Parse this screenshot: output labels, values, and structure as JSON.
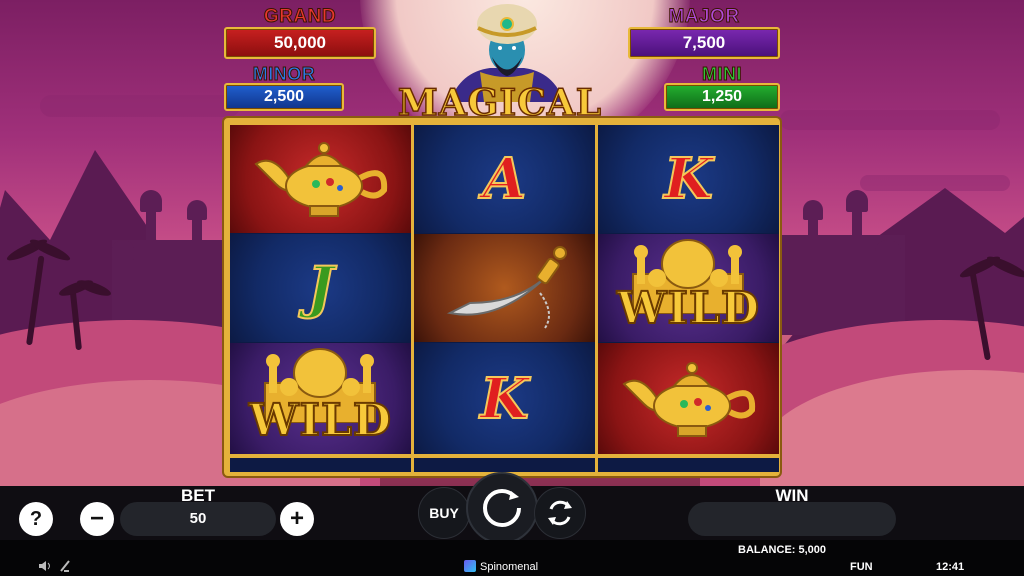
{
  "game": {
    "title": "MAGICAL GENIE"
  },
  "jackpots": {
    "grand": {
      "label": "GRAND",
      "value": "50,000"
    },
    "major": {
      "label": "MAJOR",
      "value": "7,500"
    },
    "minor": {
      "label": "MINOR",
      "value": "2,500"
    },
    "mini": {
      "label": "MINI",
      "value": "1,250"
    }
  },
  "reels": [
    [
      {
        "symbol": "magic-lamp",
        "text": ""
      },
      {
        "symbol": "letter-j",
        "text": "J"
      },
      {
        "symbol": "wild-palace",
        "text": "WILD"
      }
    ],
    [
      {
        "symbol": "letter-a",
        "text": "A"
      },
      {
        "symbol": "dagger",
        "text": ""
      },
      {
        "symbol": "letter-k",
        "text": "K"
      }
    ],
    [
      {
        "symbol": "letter-k",
        "text": "K"
      },
      {
        "symbol": "wild-palace",
        "text": "WILD"
      },
      {
        "symbol": "magic-lamp",
        "text": ""
      }
    ]
  ],
  "controls": {
    "help": "?",
    "bet_label": "BET",
    "bet_value": "50",
    "minus": "−",
    "plus": "+",
    "buy_label": "BUY",
    "win_label": "WIN",
    "win_value": ""
  },
  "status": {
    "balance": "BALANCE: 5,000",
    "brand": "Spinomenal",
    "mode": "FUN",
    "time": "12:41"
  },
  "colors": {
    "gold": "#e4b23b",
    "grand_box": "#b01818",
    "major_box": "#6a1c9a",
    "minor_box": "#1c4ab8",
    "mini_box": "#1c9a2a"
  }
}
